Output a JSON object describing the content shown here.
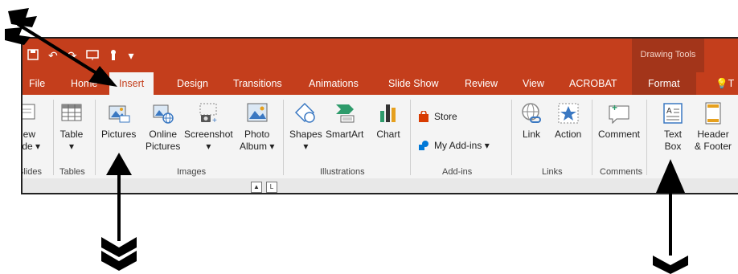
{
  "qat": {
    "undo": "↶",
    "redo": "↷",
    "customize": "▾"
  },
  "drawing_tools": "Drawing Tools",
  "tabs": [
    {
      "label": "File"
    },
    {
      "label": "Home"
    },
    {
      "label": "Insert"
    },
    {
      "label": "Design"
    },
    {
      "label": "Transitions"
    },
    {
      "label": "Animations"
    },
    {
      "label": "Slide Show"
    },
    {
      "label": "Review"
    },
    {
      "label": "View"
    },
    {
      "label": "ACROBAT"
    },
    {
      "label": "Format"
    },
    {
      "label": "T"
    }
  ],
  "ribbon": {
    "new_slide": {
      "line1": "New",
      "line2": "Slide ▾"
    },
    "table": {
      "line1": "Table",
      "line2": "▾"
    },
    "pictures": {
      "line1": "Pictures"
    },
    "online_pictures": {
      "line1": "Online",
      "line2": "Pictures"
    },
    "screenshot": {
      "line1": "Screenshot",
      "line2": "▾"
    },
    "photo_album": {
      "line1": "Photo",
      "line2": "Album ▾"
    },
    "shapes": {
      "line1": "Shapes",
      "line2": "▾"
    },
    "smartart": {
      "line1": "SmartArt"
    },
    "chart": {
      "line1": "Chart"
    },
    "store": "Store",
    "my_addins": "My Add-ins ▾",
    "link": {
      "line1": "Link"
    },
    "action": {
      "line1": "Action"
    },
    "comment": {
      "line1": "Comment"
    },
    "text_box": {
      "line1": "Text",
      "line2": "Box"
    },
    "header_footer": {
      "line1": "Header",
      "line2": "& Footer"
    },
    "groups": {
      "slides": "Slides",
      "tables": "Tables",
      "images": "Images",
      "illustrations": "Illustrations",
      "addins": "Add-ins",
      "links": "Links",
      "comments": "Comments"
    }
  },
  "colors": {
    "accent": "#c43e1c",
    "accent_dark": "#a3351a",
    "ribbon_bg": "#f4f4f4"
  }
}
